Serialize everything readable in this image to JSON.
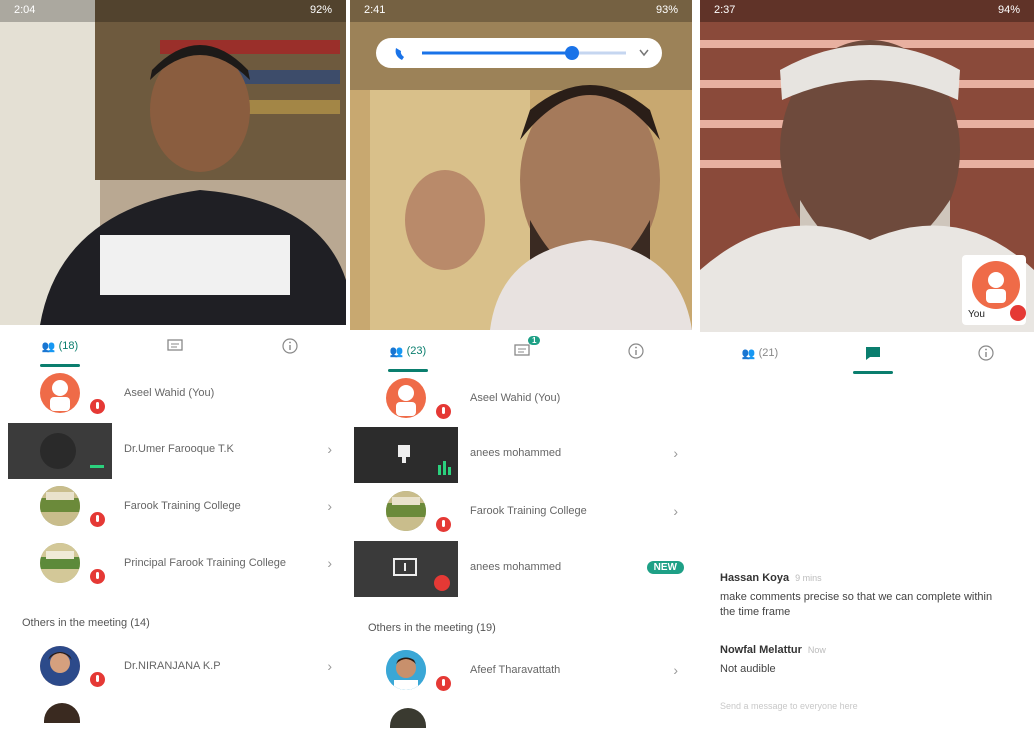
{
  "colors": {
    "accent": "#0a7e6e",
    "mic_off": "#e53935",
    "new_badge": "#1ea086"
  },
  "screens": [
    {
      "status": {
        "time": "2:04",
        "battery": "92%"
      },
      "tabs": {
        "people": "(18)",
        "chat_icon": "chat-icon",
        "info_icon": "info-icon"
      },
      "participants": [
        {
          "name": "Aseel Wahid (You)"
        },
        {
          "name": "Dr.Umer Farooque T.K"
        },
        {
          "name": "Farook Training College"
        },
        {
          "name": "Principal Farook Training College"
        }
      ],
      "others_label": "Others in the meeting (14)",
      "others": [
        {
          "name": "Dr.NIRANJANA K.P"
        }
      ]
    },
    {
      "status": {
        "time": "2:41",
        "battery": "93%"
      },
      "tabs": {
        "people": "(23)",
        "chat_badge": "1"
      },
      "participants": [
        {
          "name": "Aseel Wahid (You)"
        },
        {
          "name": "anees mohammed"
        },
        {
          "name": "Farook Training College"
        },
        {
          "name": "anees mohammed",
          "badge": "NEW"
        }
      ],
      "others_label": "Others in the meeting (19)",
      "others": [
        {
          "name": "Afeef Tharavattath"
        }
      ]
    },
    {
      "status": {
        "time": "2:37",
        "battery": "94%"
      },
      "tabs": {
        "people": "(21)"
      },
      "self_label": "You",
      "messages": [
        {
          "author": "Hassan Koya",
          "time": "9 mins",
          "text": "make comments precise so that we can complete within the time  frame"
        },
        {
          "author": "Nowfal Melattur",
          "time": "Now",
          "text": "Not audible"
        }
      ],
      "input_placeholder": "Send a message to everyone here"
    }
  ]
}
